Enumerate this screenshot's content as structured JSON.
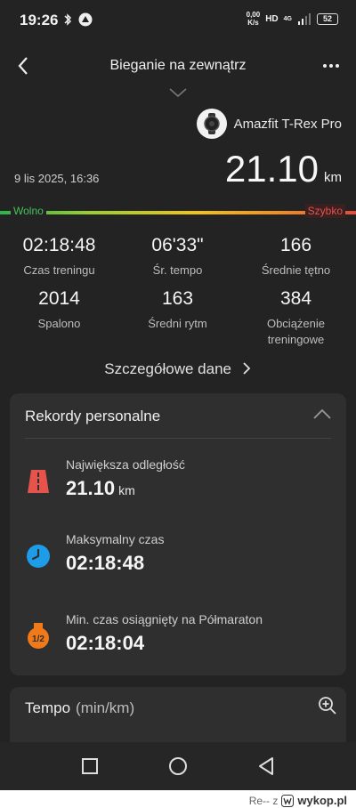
{
  "status_bar": {
    "time": "19:26",
    "net_speed_value": "0,00",
    "net_speed_unit": "K/s",
    "hd": "HD",
    "network": "4G",
    "battery": "52"
  },
  "header": {
    "title": "Bieganie na zewnątrz"
  },
  "device": {
    "name": "Amazfit T-Rex Pro"
  },
  "workout": {
    "date": "9 lis 2025, 16:36",
    "distance": "21.10",
    "distance_unit": "km",
    "pace_slow": "Wolno",
    "pace_fast": "Szybko"
  },
  "stats": [
    {
      "value": "02:18:48",
      "label": "Czas treningu"
    },
    {
      "value": "06'33\"",
      "label": "Śr. tempo"
    },
    {
      "value": "166",
      "label": "Średnie tętno"
    },
    {
      "value": "2014",
      "label": "Spalono"
    },
    {
      "value": "163",
      "label": "Średni rytm"
    },
    {
      "value": "384",
      "label": "Obciążenie treningowe"
    }
  ],
  "details_link": "Szczegółowe dane",
  "records": {
    "title": "Rekordy personalne",
    "items": [
      {
        "label": "Największa odległość",
        "value": "21.10",
        "unit": "km",
        "icon": "road-icon"
      },
      {
        "label": "Maksymalny czas",
        "value": "02:18:48",
        "unit": "",
        "icon": "clock-icon"
      },
      {
        "label": "Min. czas osiągnięty na Półmaraton",
        "value": "02:18:04",
        "unit": "",
        "icon": "half-marathon-medal-icon",
        "badge": "1/2"
      }
    ]
  },
  "tempo": {
    "title": "Tempo",
    "unit": "(min/km)"
  },
  "watermark": {
    "user": "Re-- z",
    "site": "wykop.pl"
  },
  "colors": {
    "background": "#232323",
    "card": "#2f2f2f",
    "slow": "#47c25a",
    "fast": "#e5534b",
    "road_icon": "#e5534b",
    "clock_icon": "#1e9be9",
    "medal_icon": "#f07a1a"
  }
}
